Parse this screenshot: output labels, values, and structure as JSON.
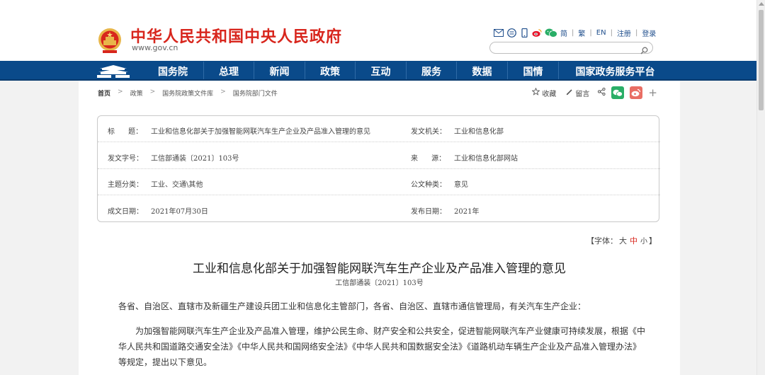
{
  "header": {
    "site_title": "中华人民共和国中央人民政府",
    "site_url": "www.gov.cn",
    "lang_links": [
      "简",
      "繁",
      "EN"
    ],
    "register": "注册",
    "login": "登录",
    "search_placeholder": ""
  },
  "nav": {
    "items": [
      {
        "label": "国务院",
        "w": 86
      },
      {
        "label": "总理",
        "w": 71
      },
      {
        "label": "新闻",
        "w": 72
      },
      {
        "label": "政策",
        "w": 71
      },
      {
        "label": "互动",
        "w": 72
      },
      {
        "label": "服务",
        "w": 71
      },
      {
        "label": "数据",
        "w": 72
      },
      {
        "label": "国情",
        "w": 72
      },
      {
        "label": "国家政务服务平台",
        "w": 160
      }
    ]
  },
  "breadcrumb": {
    "home": "首页",
    "items": [
      "政策",
      "国务院政策文件库",
      "国务院部门文件"
    ]
  },
  "actions": {
    "favorite": "收藏",
    "comment": "留言"
  },
  "meta": {
    "rows": [
      {
        "l1": "标      题：",
        "v1": "工业和信息化部关于加强智能网联汽车生产企业及产品准入管理的意见",
        "l2": "发文机关：",
        "v2": "工业和信息化部"
      },
      {
        "l1": "发文字号：",
        "v1": "工信部通装〔2021〕103号",
        "l2": "来      源：",
        "v2": "工业和信息化部网站"
      },
      {
        "l1": "主题分类：",
        "v1": "工业、交通\\其他",
        "l2": "公文种类：",
        "v2": "意见"
      },
      {
        "l1": "成文日期：",
        "v1": "2021年07月30日",
        "l2": "发布日期：",
        "v2": "2021年"
      }
    ]
  },
  "fontsize": {
    "prefix": "【字体：",
    "large": "大",
    "medium": "中",
    "small": "小",
    "suffix": "】"
  },
  "document": {
    "title": "工业和信息化部关于加强智能网联汽车生产企业及产品准入管理的意见",
    "number": "工信部通装〔2021〕103号",
    "para1": "各省、自治区、直辖市及新疆生产建设兵团工业和信息化主管部门，各省、自治区、直辖市通信管理局，有关汽车生产企业：",
    "para2": "为加强智能网联汽车生产企业及产品准入管理，维护公民生命、财产安全和公共安全，促进智能网联汽车产业健康可持续发展，根据《中华人民共和国道路交通安全法》《中华人民共和国网络安全法》《中华人民共和国数据安全法》《道路机动车辆生产企业及产品准入管理办法》等规定，提出以下意见。"
  },
  "colors": {
    "brand_red": "#d8261d",
    "nav_blue": "#0a4a8a"
  }
}
